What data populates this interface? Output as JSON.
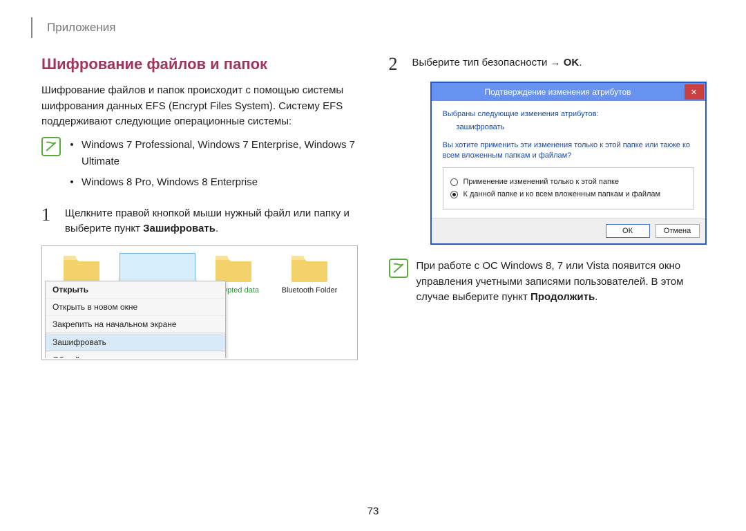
{
  "breadcrumb": "Приложения",
  "section_title": "Шифрование файлов и папок",
  "intro": "Шифрование файлов и папок происходит с помощью системы шифрования данных EFS (Encrypt Files System). Систему EFS поддерживают следующие операционные системы:",
  "note_bullets": [
    "Windows 7 Professional, Windows 7 Enterprise, Windows 7 Ultimate",
    "Windows 8 Pro, Windows 8 Enterprise"
  ],
  "step1": {
    "num": "1",
    "text_a": "Щелкните правой кнопкой мыши нужный файл или папку и выберите пункт ",
    "text_bold": "Зашифровать",
    "text_b": "."
  },
  "ctx_menu": {
    "items": [
      "Открыть",
      "Открыть в новом окне",
      "Закрепить на начальном экране",
      "Зашифровать",
      "Общий доступ"
    ]
  },
  "folder_labels": {
    "encrypted": "Encrypted data",
    "bluetooth": "Bluetooth Folder"
  },
  "step2": {
    "num": "2",
    "text_a": "Выберите тип безопасности ",
    "arrow": "→",
    "text_bold": " OK",
    "text_b": "."
  },
  "dialog": {
    "title": "Подтверждение изменения атрибутов",
    "line1": "Выбраны следующие изменения атрибутов:",
    "line2": "зашифровать",
    "line3": "Вы хотите применить эти изменения только к этой папке или также ко всем вложенным папкам и файлам?",
    "radio1": "Применение изменений только к этой папке",
    "radio2": "К данной папке и ко всем вложенным папкам и файлам",
    "ok": "ОК",
    "cancel": "Отмена"
  },
  "note2": {
    "text_a": "При работе с ОС Windows 8, 7 или Vista появится окно управления учетными записями пользователей. В этом случае выберите пункт ",
    "text_bold": "Продолжить",
    "text_b": "."
  },
  "page_num": "73"
}
